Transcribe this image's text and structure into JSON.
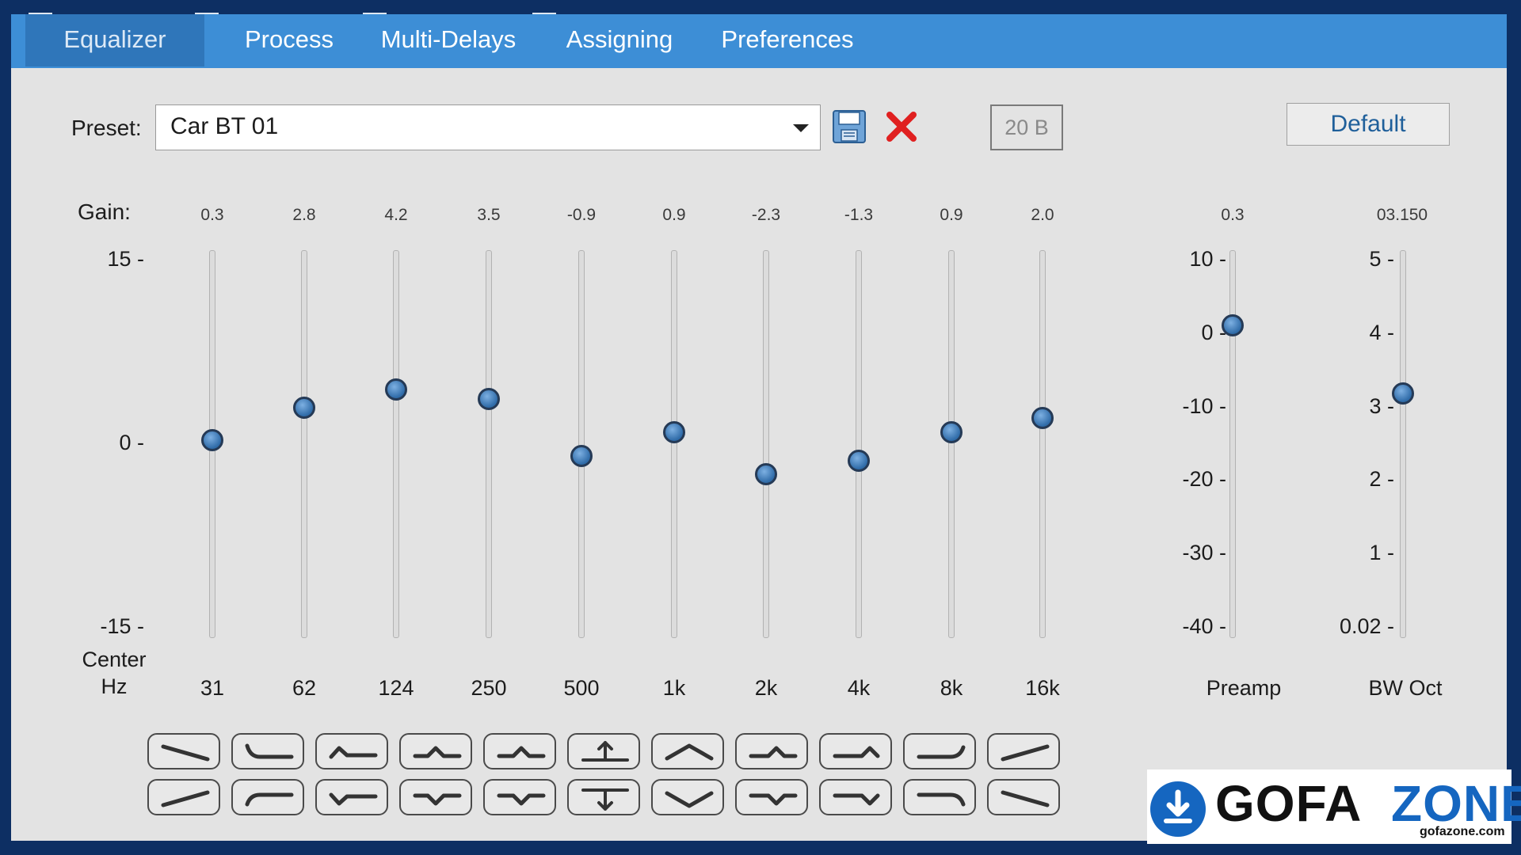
{
  "tabs": [
    {
      "label": "Equalizer",
      "active": true
    },
    {
      "label": "Process",
      "active": false
    },
    {
      "label": "Multi-Delays",
      "active": false
    },
    {
      "label": "Assigning",
      "active": false
    },
    {
      "label": "Preferences",
      "active": false
    }
  ],
  "preset": {
    "label": "Preset:",
    "value": "Car BT 01",
    "save_icon": "floppy-disk-icon",
    "delete_icon": "red-x-icon",
    "bands_label": "20 B",
    "default_label": "Default"
  },
  "gain_label": "Gain:",
  "center_label_1": "Center",
  "center_label_2": "Hz",
  "gain_scale": [
    "15 -",
    "0 -",
    "-15 -"
  ],
  "bands": [
    {
      "hz": "31",
      "gain_text": "0.3",
      "gain": 0.3
    },
    {
      "hz": "62",
      "gain_text": "2.8",
      "gain": 2.8
    },
    {
      "hz": "124",
      "gain_text": "4.2",
      "gain": 4.2
    },
    {
      "hz": "250",
      "gain_text": "3.5",
      "gain": 3.5
    },
    {
      "hz": "500",
      "gain_text": "-0.9",
      "gain": -0.9
    },
    {
      "hz": "1k",
      "gain_text": "0.9",
      "gain": 0.9
    },
    {
      "hz": "2k",
      "gain_text": "-2.3",
      "gain": -2.3
    },
    {
      "hz": "4k",
      "gain_text": "-1.3",
      "gain": -1.3
    },
    {
      "hz": "8k",
      "gain_text": "0.9",
      "gain": 0.9
    },
    {
      "hz": "16k",
      "gain_text": "2.0",
      "gain": 2.0
    }
  ],
  "preamp": {
    "label": "Preamp",
    "value_text": "0.3",
    "value": 0.3,
    "scale": [
      "10 -",
      "0 -",
      "-10 -",
      "-20 -",
      "-30 -",
      "-40 -"
    ]
  },
  "bw": {
    "label": "BW Oct",
    "value_text": "03.150",
    "value": 3.15,
    "scale": [
      "5 -",
      "4 -",
      "3 -",
      "2 -",
      "1 -",
      "0.02 -"
    ]
  },
  "shape_buttons": {
    "top_row": [
      "tilt-down-icon",
      "low-shelf-cut-icon",
      "bump-low-icon",
      "bump-lowmid-icon",
      "bump-mid-icon",
      "raise-all-icon",
      "peak-center-icon",
      "bump-highmid-icon",
      "bump-high-icon",
      "high-shelf-cut-icon",
      "tilt-up-icon"
    ],
    "bottom_row": [
      "tilt-up-icon",
      "low-shelf-boost-icon",
      "dip-low-icon",
      "dip-lowmid-icon",
      "dip-mid-icon",
      "lower-all-icon",
      "valley-center-icon",
      "dip-highmid-icon",
      "dip-high-icon",
      "high-shelf-boost-icon",
      "tilt-down-icon"
    ]
  },
  "watermark": {
    "word1": "GOFA",
    "word2": "ZONE",
    "site": "gofazone.com",
    "icon": "download-arrow-icon"
  },
  "colors": {
    "tabbar": "#3d8ed6",
    "active_tab": "#2f76ba",
    "knob": "#2f6ba8",
    "delete_red": "#e02020",
    "brand_blue": "#1566c0"
  }
}
